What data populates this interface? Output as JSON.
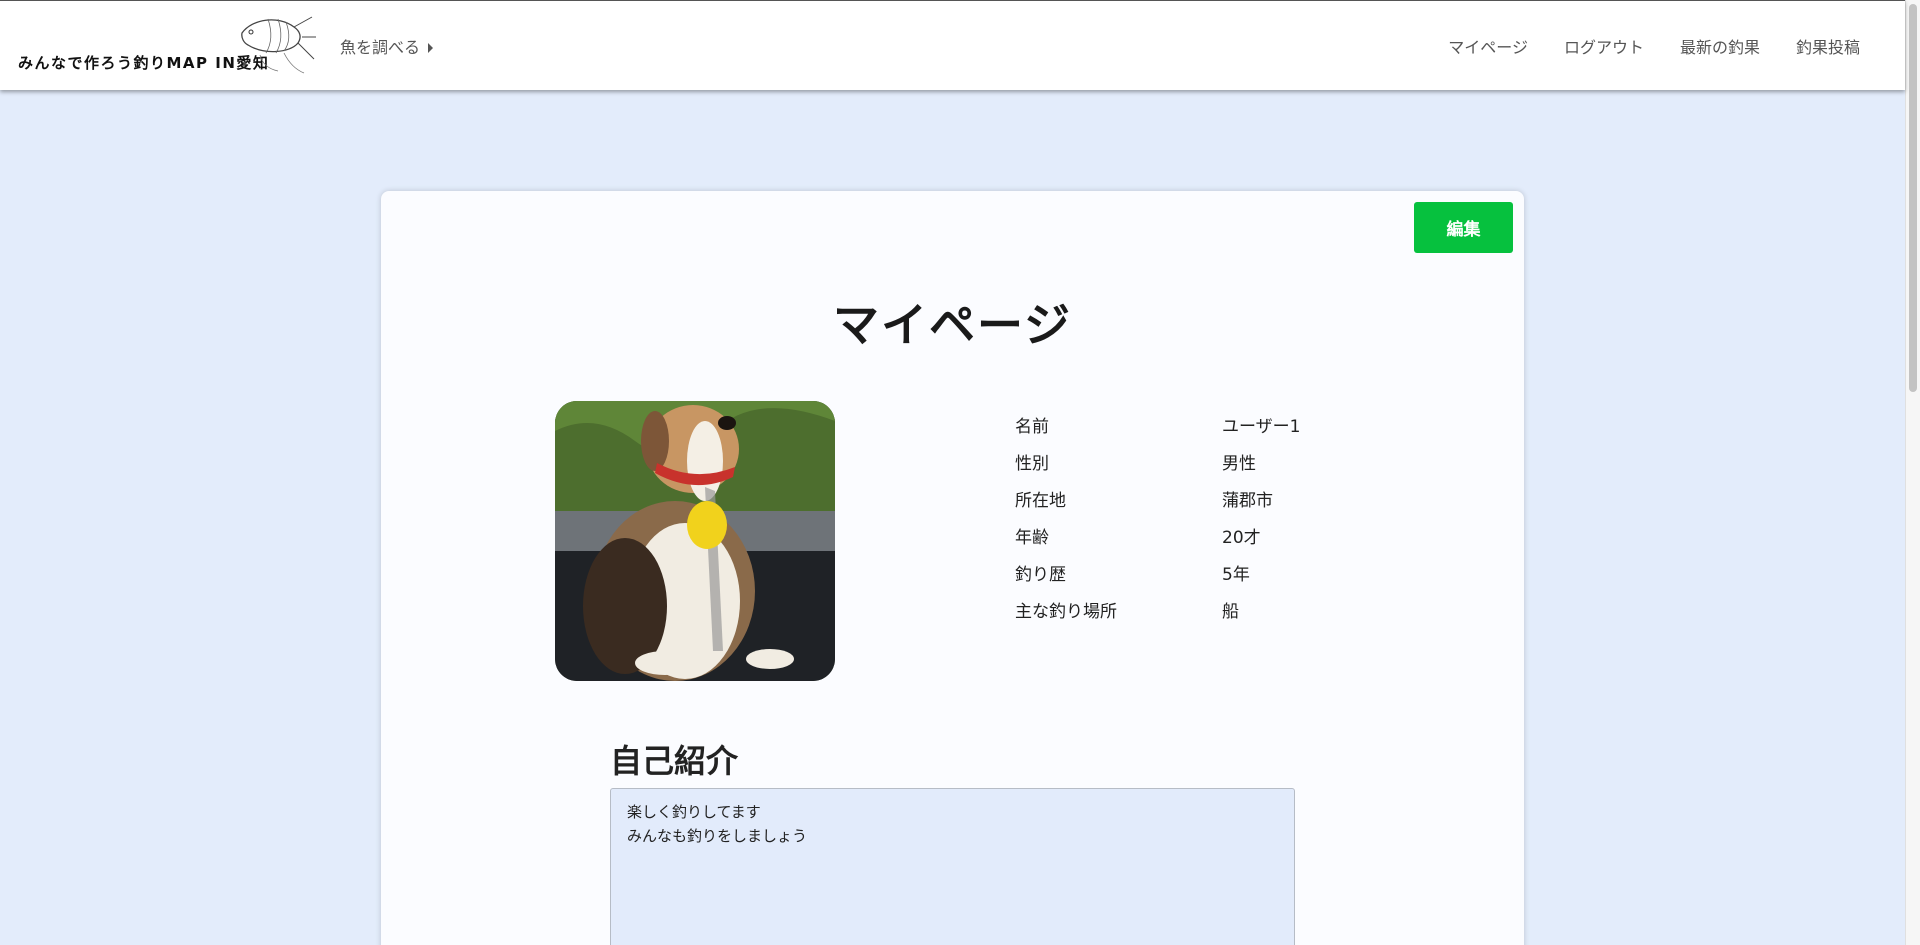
{
  "header": {
    "logo_text": "みんなで作ろう釣りMAP IN愛知",
    "fish_menu_label": "魚を調べる",
    "nav": [
      {
        "label": "マイページ"
      },
      {
        "label": "ログアウト"
      },
      {
        "label": "最新の釣果"
      },
      {
        "label": "釣果投稿"
      }
    ]
  },
  "main": {
    "edit_button": "編集",
    "title": "マイページ",
    "profile": {
      "rows": [
        {
          "label": "名前",
          "value": "ユーザー1"
        },
        {
          "label": "性別",
          "value": "男性"
        },
        {
          "label": "所在地",
          "value": "蒲郡市"
        },
        {
          "label": "年齢",
          "value": "20才"
        },
        {
          "label": "釣り歴",
          "value": "5年"
        },
        {
          "label": "主な釣り場所",
          "value": "船"
        }
      ]
    },
    "intro": {
      "heading": "自己紹介",
      "text": "楽しく釣りしてます\nみんなも釣りをしましょう"
    }
  },
  "colors": {
    "page_background": "#e3ecfb",
    "edit_button": "#06c13e",
    "intro_box": "#e2ebfb"
  }
}
